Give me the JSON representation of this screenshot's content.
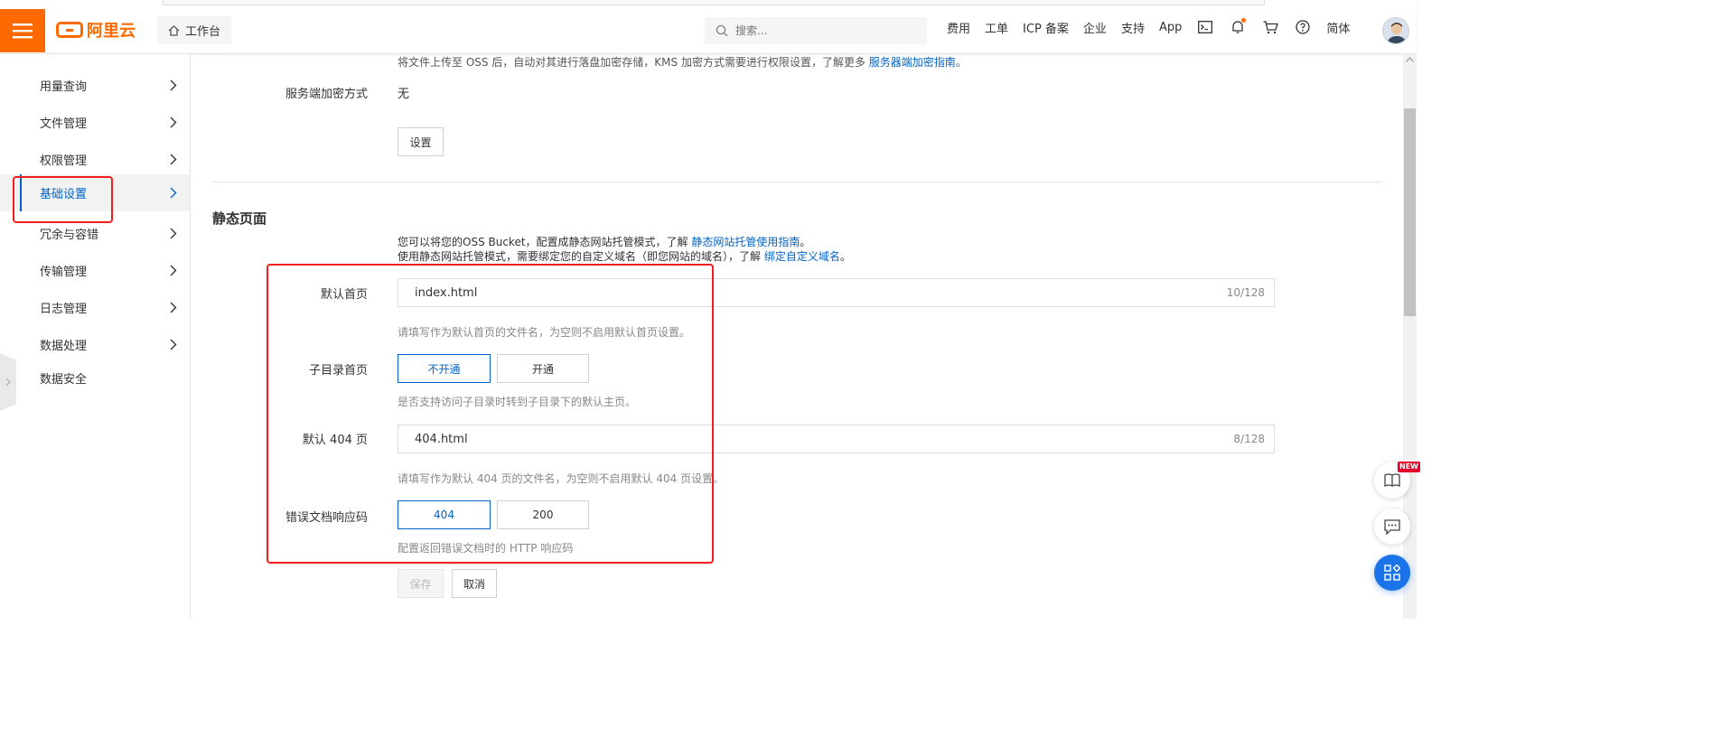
{
  "header": {
    "logo_text": "阿里云",
    "workbench_label": "工作台",
    "search_placeholder": "搜索...",
    "nav_links": [
      "费用",
      "工单",
      "ICP 备案",
      "企业",
      "支持",
      "App"
    ],
    "lang_label": "简体",
    "accent_color": "#ff6a00"
  },
  "sidebar": {
    "items": [
      {
        "label": "用量查询"
      },
      {
        "label": "文件管理"
      },
      {
        "label": "权限管理"
      },
      {
        "label": "基础设置"
      },
      {
        "label": "冗余与容错"
      },
      {
        "label": "传输管理"
      },
      {
        "label": "日志管理"
      },
      {
        "label": "数据处理"
      },
      {
        "label": "数据安全"
      }
    ],
    "active_item": "基础设置",
    "active_color": "#0064c8"
  },
  "encryption": {
    "desc_text": "将文件上传至 OSS 后，自动对其进行落盘加密存储，KMS 加密方式需要进行权限设置，了解更多",
    "desc_link": "服务器端加密指南",
    "desc_end": "。",
    "label": "服务端加密方式",
    "value": "无",
    "settings_button": "设置"
  },
  "static_page": {
    "title": "静态页面",
    "intro_line1_text": "您可以将您的OSS Bucket，配置成静态网站托管模式，了解",
    "intro_line1_link": "静态网站托管使用指南",
    "intro_line1_end": "。",
    "intro_line2_text": "使用静态网站托管模式，需要绑定您的自定义域名（即您网站的域名），了解",
    "intro_line2_link": "绑定自定义域名",
    "intro_line2_end": "。",
    "default_index": {
      "label": "默认首页",
      "value": "index.html",
      "counter": "10/128",
      "hint": "请填写作为默认首页的文件名，为空则不启用默认首页设置。"
    },
    "subdir_index": {
      "label": "子目录首页",
      "options": [
        "不开通",
        "开通"
      ],
      "selected": "不开通",
      "hint": "是否支持访问子目录时转到子目录下的默认主页。"
    },
    "default_404": {
      "label": "默认 404 页",
      "value": "404.html",
      "counter": "8/128",
      "hint": "请填写作为默认 404 页的文件名，为空则不启用默认 404 页设置。"
    },
    "error_code": {
      "label": "错误文档响应码",
      "options": [
        "404",
        "200"
      ],
      "selected": "404",
      "hint": "配置返回错误文档时的 HTTP 响应码"
    },
    "save_button": "保存",
    "cancel_button": "取消"
  },
  "floating": {
    "new_badge": "NEW"
  }
}
